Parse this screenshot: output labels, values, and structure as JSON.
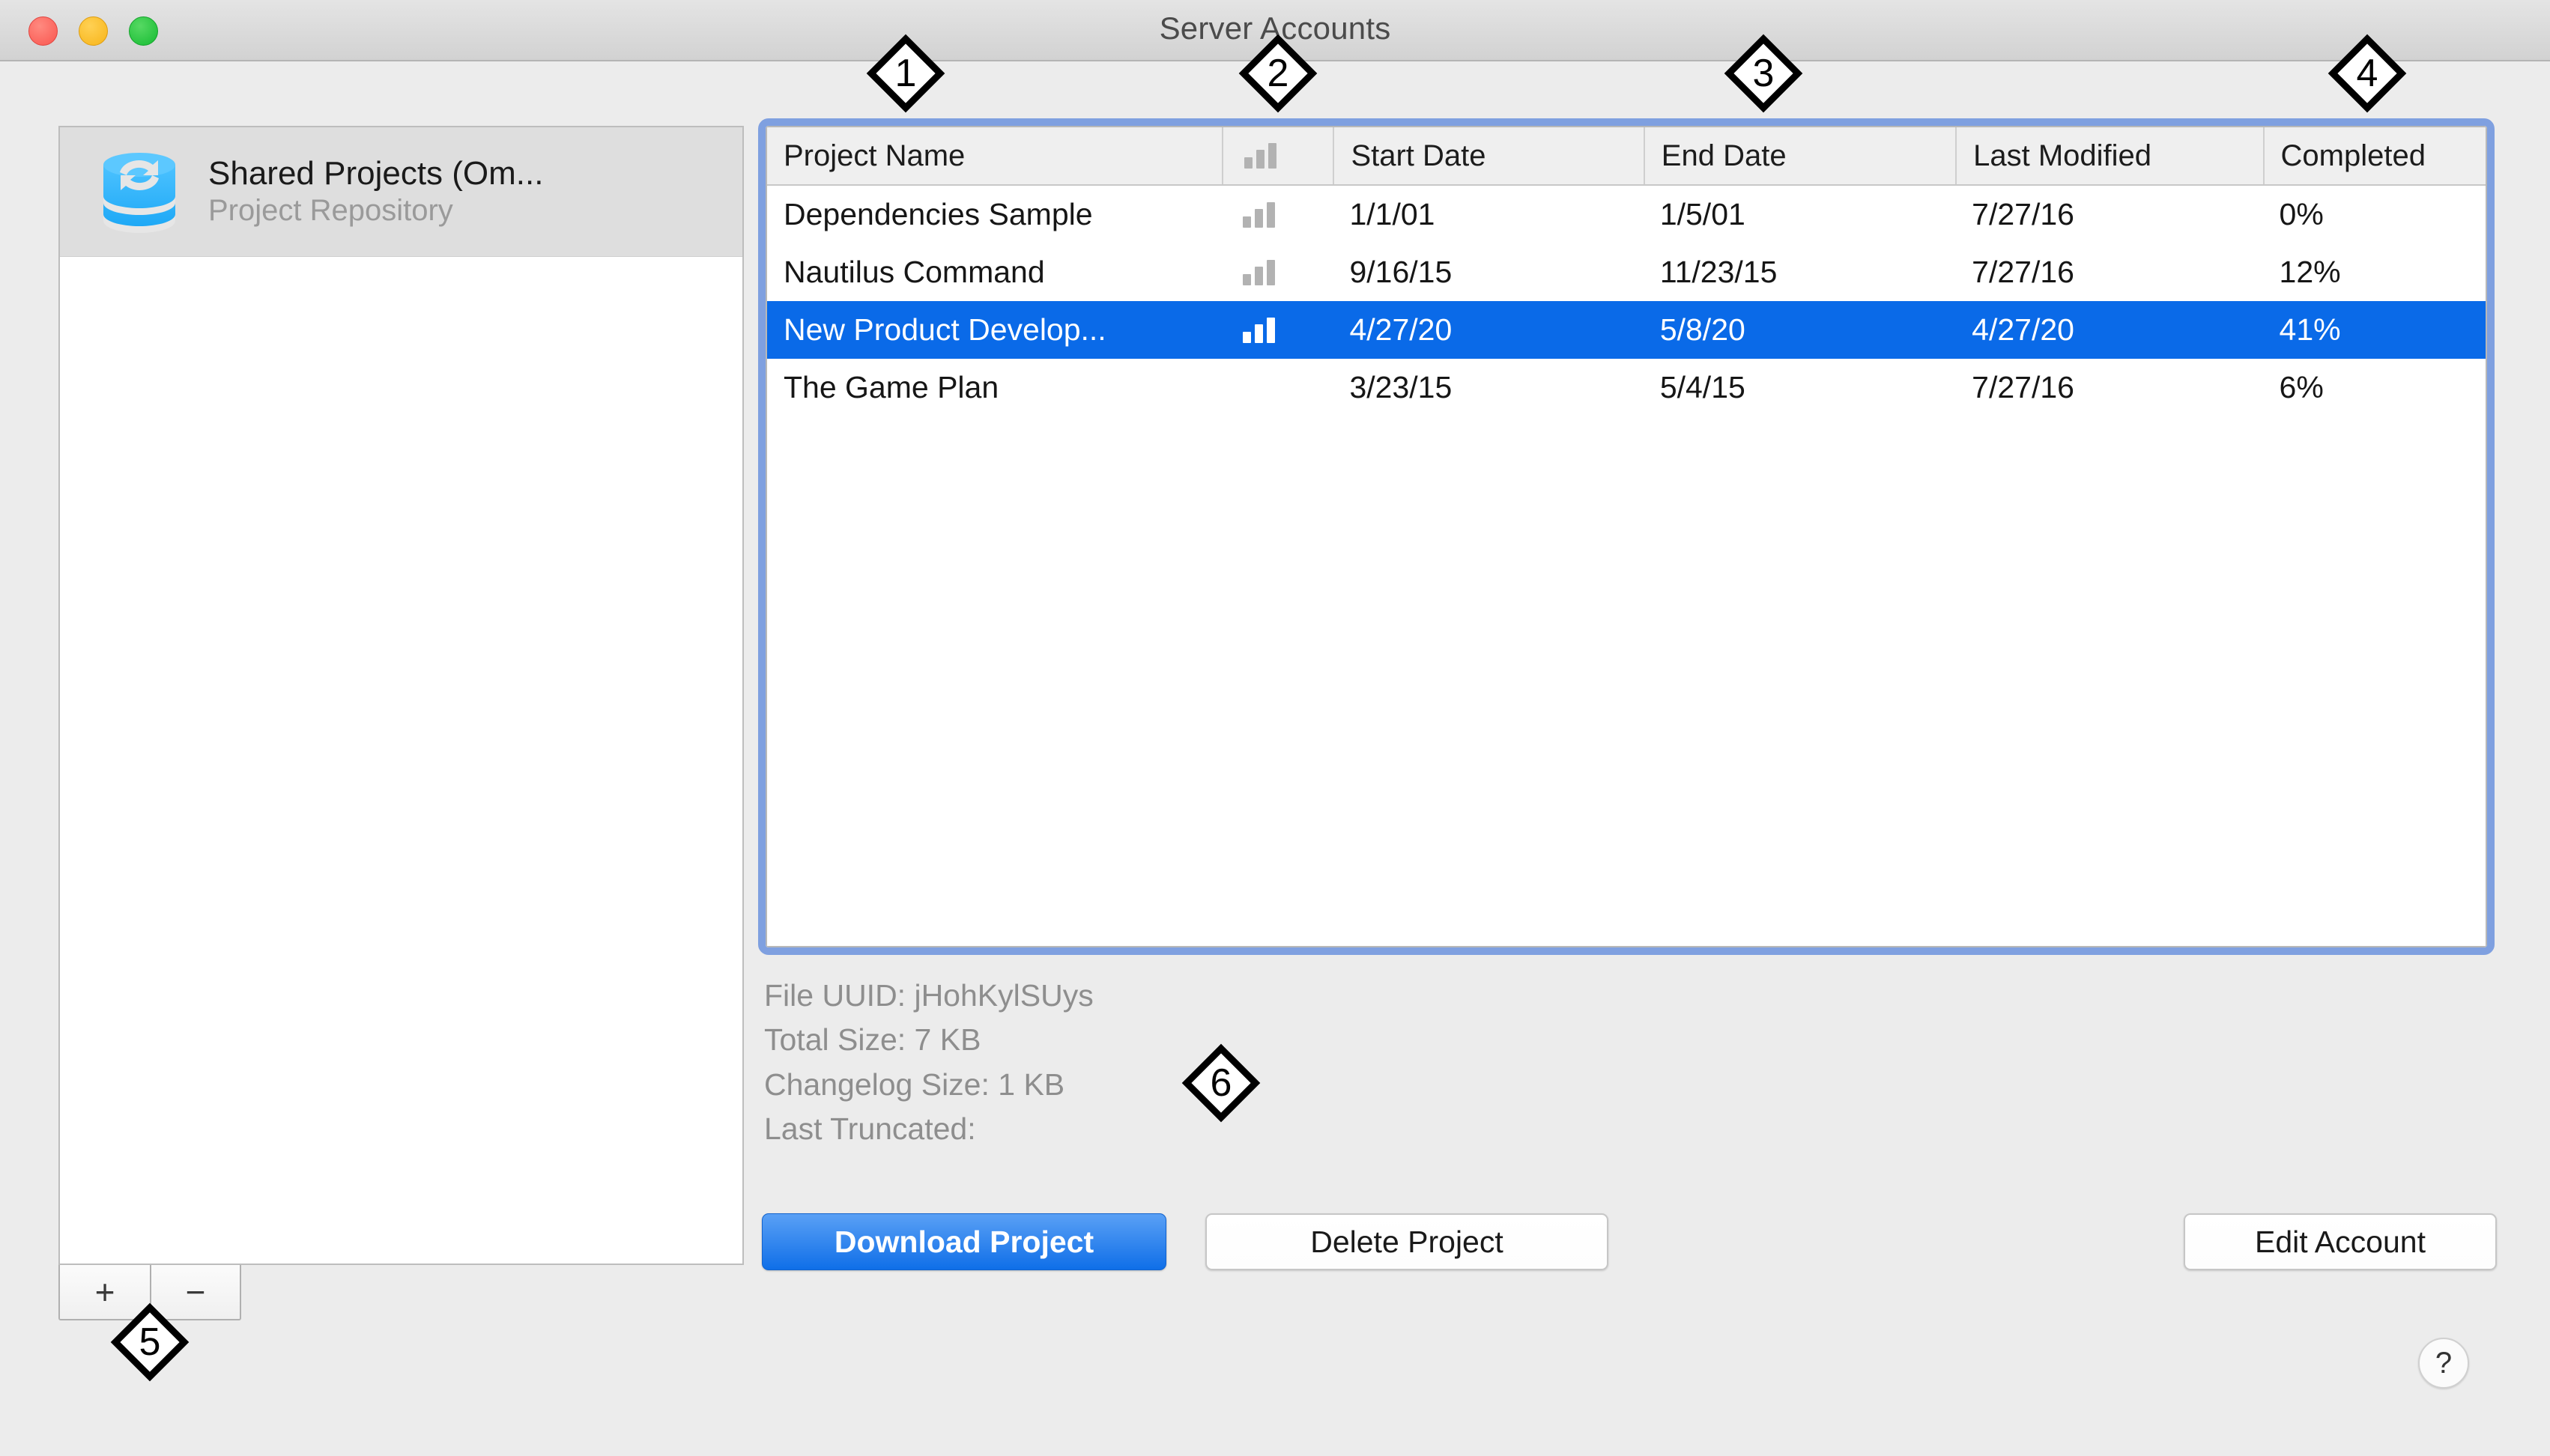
{
  "window": {
    "title": "Server Accounts",
    "traffic_lights": [
      "close",
      "minimize",
      "zoom"
    ]
  },
  "sidebar": {
    "items": [
      {
        "icon": "database-sync-icon",
        "title": "Shared Projects (Om...",
        "subtitle": "Project Repository",
        "selected": true
      }
    ],
    "controls": {
      "add_label": "+",
      "remove_label": "−"
    }
  },
  "table": {
    "columns": [
      {
        "key": "name",
        "label": "Project Name"
      },
      {
        "key": "bars",
        "label": "",
        "icon": "bar-chart-icon"
      },
      {
        "key": "start",
        "label": "Start Date"
      },
      {
        "key": "end",
        "label": "End Date"
      },
      {
        "key": "mod",
        "label": "Last Modified"
      },
      {
        "key": "done",
        "label": "Completed"
      }
    ],
    "rows": [
      {
        "name": "Dependencies Sample",
        "bars": true,
        "start": "1/1/01",
        "end": "1/5/01",
        "mod": "7/27/16",
        "done": "0%",
        "selected": false
      },
      {
        "name": "Nautilus Command",
        "bars": true,
        "start": "9/16/15",
        "end": "11/23/15",
        "mod": "7/27/16",
        "done": "12%",
        "selected": false
      },
      {
        "name": "New Product Develop...",
        "bars": true,
        "start": "4/27/20",
        "end": "5/8/20",
        "mod": "4/27/20",
        "done": "41%",
        "selected": true
      },
      {
        "name": "The Game Plan",
        "bars": false,
        "start": "3/23/15",
        "end": "5/4/15",
        "mod": "7/27/16",
        "done": "6%",
        "selected": false
      }
    ]
  },
  "info": {
    "file_uuid": "File UUID: jHohKylSUys",
    "total_size": "Total Size: 7 KB",
    "changelog_size": "Changelog Size: 1 KB",
    "last_truncated": "Last Truncated:"
  },
  "buttons": {
    "download": "Download Project",
    "delete": "Delete Project",
    "edit_account": "Edit Account",
    "help": "?"
  },
  "markers": [
    {
      "id": "1",
      "label": "1"
    },
    {
      "id": "2",
      "label": "2"
    },
    {
      "id": "3",
      "label": "3"
    },
    {
      "id": "4",
      "label": "4"
    },
    {
      "id": "5",
      "label": "5"
    },
    {
      "id": "6",
      "label": "6"
    }
  ],
  "colors": {
    "selection_blue": "#0a6ae8",
    "focus_ring_blue": "#7fa0e0",
    "default_button_blue": "#0f6fe8",
    "icon_blue": "#35b2f7",
    "window_bg": "#ececec",
    "muted_text": "#8e8e8e"
  }
}
